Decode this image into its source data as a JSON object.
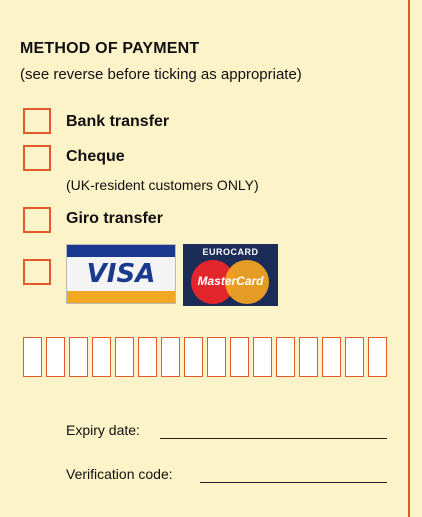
{
  "header": {
    "title": "METHOD OF PAYMENT",
    "subtitle": "(see reverse before ticking as appropriate)"
  },
  "options": {
    "bank_transfer": "Bank transfer",
    "cheque": "Cheque",
    "cheque_note": "(UK-resident customers ONLY)",
    "giro_transfer": "Giro transfer"
  },
  "cards": {
    "visa_text": "VISA",
    "eurocard_text": "EUROCARD",
    "mastercard_text": "MasterCard"
  },
  "card_number": {
    "digit_count": 16
  },
  "fields": {
    "expiry_label": "Expiry date:",
    "verification_label": "Verification code:"
  },
  "colors": {
    "background": "#fdf3c9",
    "accent": "#e25a2a"
  }
}
